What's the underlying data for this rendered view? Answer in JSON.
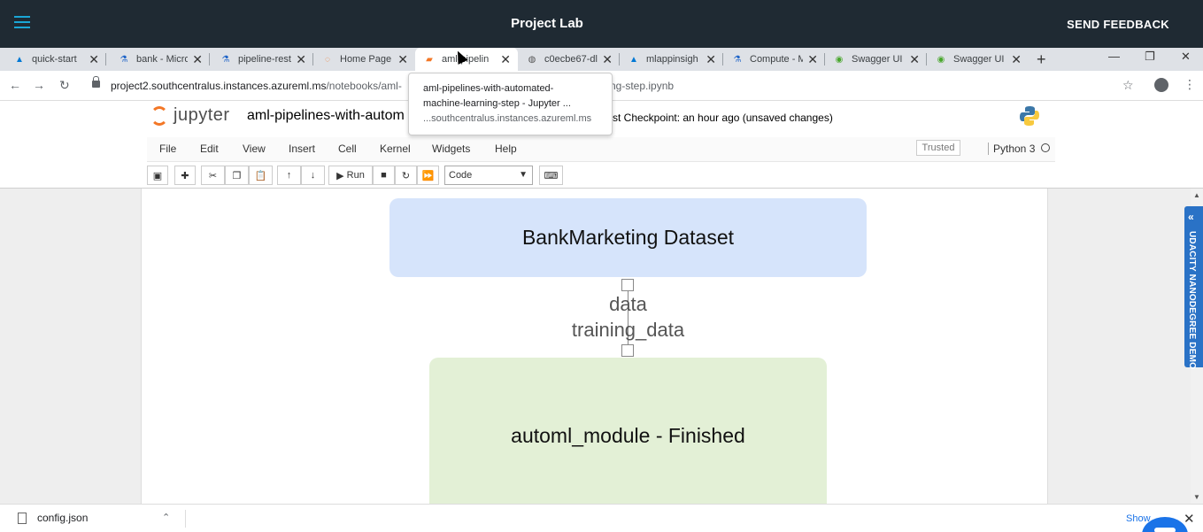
{
  "topbar": {
    "title": "Project Lab",
    "feedback": "SEND FEEDBACK"
  },
  "tabs": [
    {
      "label": "quick-start",
      "icon": "azure-icon"
    },
    {
      "label": "bank - Micro",
      "icon": "flask-icon"
    },
    {
      "label": "pipeline-rest",
      "icon": "flask-icon"
    },
    {
      "label": "Home Page",
      "icon": "jupyter-icon"
    },
    {
      "label": "aml-pipelin",
      "icon": "notebook-icon",
      "active": true
    },
    {
      "label": "c0ecbe67-dl",
      "icon": "globe-icon"
    },
    {
      "label": "mlappinsigh",
      "icon": "azure-icon"
    },
    {
      "label": "Compute - M",
      "icon": "flask-icon"
    },
    {
      "label": "Swagger UI",
      "icon": "swagger-icon"
    },
    {
      "label": "Swagger UI",
      "icon": "swagger-icon"
    }
  ],
  "address": {
    "url_host": "project2.southcentralus.instances.azureml.ms",
    "url_path": "/notebooks/aml-",
    "url_tail": "ng-step.ipynb"
  },
  "tooltip": {
    "line1": "aml-pipelines-with-automated-",
    "line2": "machine-learning-step - Jupyter ...",
    "line3": "...southcentralus.instances.azureml.ms"
  },
  "jupyter": {
    "logo_text": "jupyter",
    "notebook_name": "aml-pipelines-with-autom",
    "checkpoint": "st Checkpoint: an hour ago  (unsaved changes)",
    "menu": [
      "File",
      "Edit",
      "View",
      "Insert",
      "Cell",
      "Kernel",
      "Widgets",
      "Help"
    ],
    "trusted": "Trusted",
    "kernel": "Python 3",
    "toolbar": {
      "run": "Run",
      "cell_type": "Code"
    }
  },
  "graph": {
    "dataset_node": "BankMarketing Dataset",
    "edge_label_1": "data",
    "edge_label_2": "training_data",
    "automl_node": "automl_module - Finished"
  },
  "sidepanel": {
    "label": "UDACITY NANODEGREE DEMO"
  },
  "downloads": {
    "file": "config.json",
    "show_all": "Show"
  }
}
